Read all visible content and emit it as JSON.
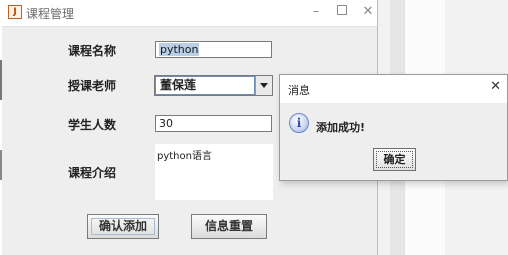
{
  "main_window": {
    "title": "课程管理",
    "fields": {
      "course_name": {
        "label": "课程名称",
        "value": "python"
      },
      "teacher": {
        "label": "授课老师",
        "value": "董保莲"
      },
      "student_count": {
        "label": "学生人数",
        "value": "30"
      },
      "intro": {
        "label": "课程介绍",
        "value": "python语言"
      }
    },
    "buttons": {
      "confirm_add": "确认添加",
      "reset": "信息重置"
    }
  },
  "dialog": {
    "title": "消息",
    "message": "添加成功!",
    "ok_label": "确定"
  }
}
